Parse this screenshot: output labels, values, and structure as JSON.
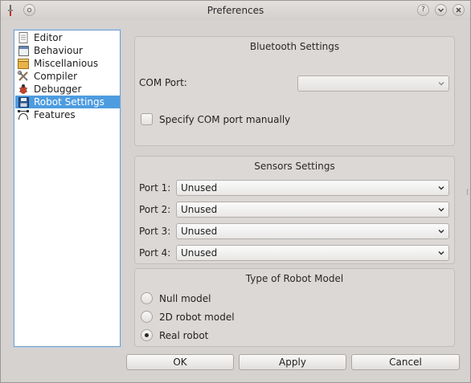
{
  "window": {
    "title": "Preferences"
  },
  "titlebar": {
    "help": "?",
    "minimize": "⌄",
    "close": "✕"
  },
  "sidebar": {
    "items": [
      {
        "label": "Editor",
        "icon": "document-icon"
      },
      {
        "label": "Behaviour",
        "icon": "window-icon"
      },
      {
        "label": "Miscellanious",
        "icon": "box-icon"
      },
      {
        "label": "Compiler",
        "icon": "tools-icon"
      },
      {
        "label": "Debugger",
        "icon": "bug-icon"
      },
      {
        "label": "Robot Settings",
        "icon": "floppy-icon",
        "selected": true
      },
      {
        "label": "Features",
        "icon": "bezier-icon"
      }
    ]
  },
  "bluetooth": {
    "title": "Bluetooth Settings",
    "com_port_label": "COM Port:",
    "com_port_value": "",
    "manual_label": "Specify COM port manually",
    "manual_checked": false
  },
  "sensors": {
    "title": "Sensors Settings",
    "ports": [
      {
        "label": "Port 1:",
        "value": "Unused"
      },
      {
        "label": "Port 2:",
        "value": "Unused"
      },
      {
        "label": "Port 3:",
        "value": "Unused"
      },
      {
        "label": "Port 4:",
        "value": "Unused"
      }
    ]
  },
  "model": {
    "title": "Type of Robot Model",
    "options": [
      {
        "label": "Null model",
        "checked": false
      },
      {
        "label": "2D robot model",
        "checked": false
      },
      {
        "label": "Real robot",
        "checked": true
      }
    ]
  },
  "buttons": {
    "ok": "OK",
    "apply": "Apply",
    "cancel": "Cancel"
  },
  "colors": {
    "selection": "#4d9ce0",
    "window_bg": "#d6d2d0"
  }
}
